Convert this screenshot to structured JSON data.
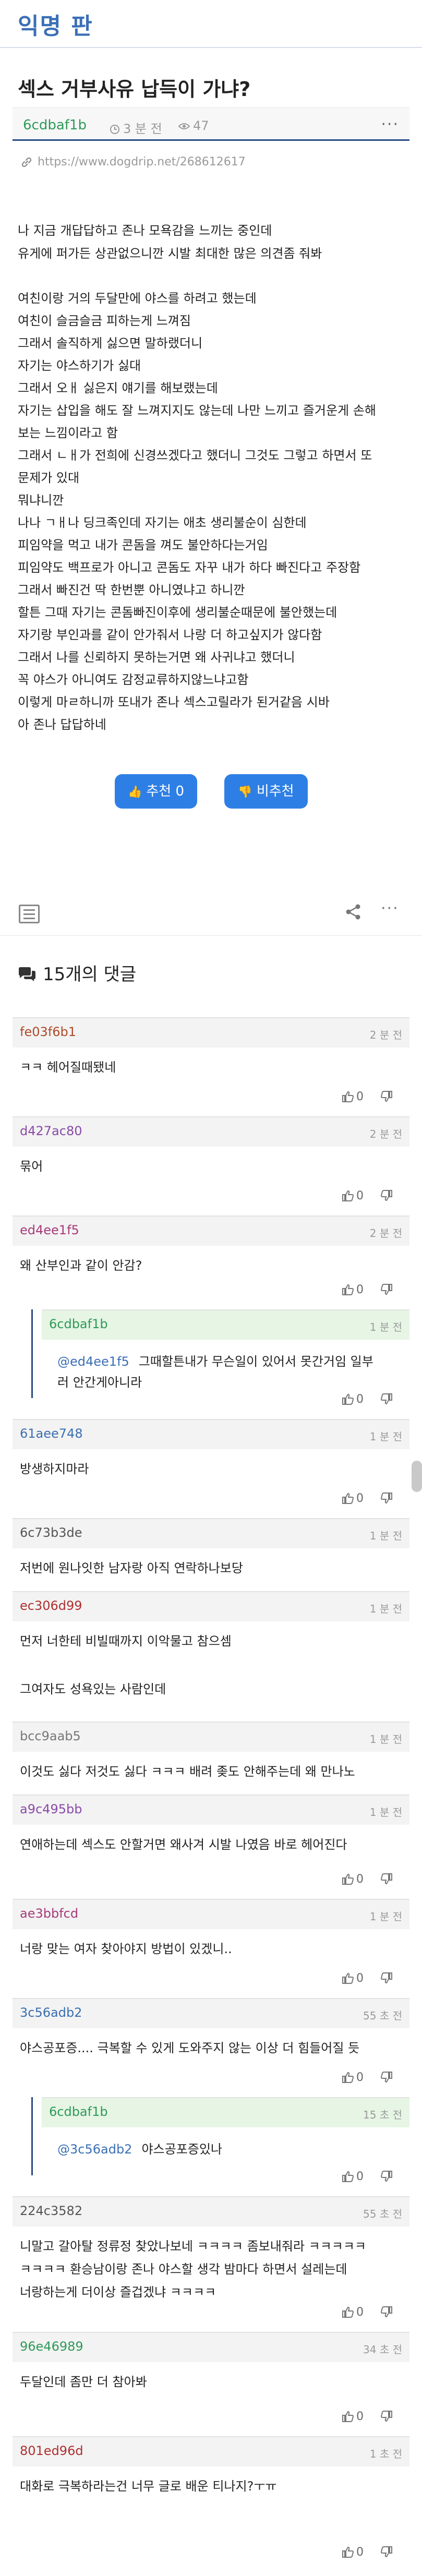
{
  "board": {
    "title": "익명 판"
  },
  "post": {
    "title": "섹스 거부사유 납득이 가냐?",
    "author": "6cdbaf1b",
    "time": "3 분 전",
    "views": "47",
    "more": "···",
    "url": "https://www.dogdrip.net/268612617",
    "body_lines": [
      "나 지금 개답답하고 존나 모욕감을 느끼는 중인데",
      "유게에 퍼가든 상관없으니깐 시발 최대한 많은 의견좀 줘봐",
      "",
      "여친이랑 거의 두달만에 야스를 하려고 했는데",
      "여친이 슬금슬금 피하는게 느껴짐",
      "그래서 솔직하게 싫으면 말하랬더니",
      "자기는 야스하기가 싫대",
      "그래서 오ㅐ 싫은지 얘기를 해보랬는데",
      "자기는 삽입을 해도 잘 느껴지지도 않는데 나만 느끼고 즐거운게 손해",
      "보는 느낌이라고 함",
      "그래서 ㄴㅐ가 전희에 신경쓰겠다고 했더니 그것도 그렇고 하면서 또",
      "문제가 있대",
      "뭐냐니깐",
      "나나 ㄱㅐ나 딩크족인데 자기는 애초 생리불순이 심한데",
      "피임약을 먹고 내가 콘돔을 껴도 불안하다는거임",
      "피임약도 백프로가 아니고 콘돔도 자꾸 내가 하다 빠진다고 주장함",
      "그래서 빠진건 딱 한번뿐 아니였냐고 하니깐",
      "할튼 그때 자기는 콘돔빠진이후에 생리불순때문에 불안했는데",
      "자기랑 부인과를 같이 안가줘서 나랑 더 하고싶지가 않다함",
      "그래서 나를 신뢰하지 못하는거면 왜 사귀냐고 했더니",
      "꼭 야스가 아니여도 감정교류하지않느냐고함",
      "이렇게 마ㄹ하니까 또내가 존나 섹스고릴라가 된거같음 시바",
      "아 존나 답답하네"
    ],
    "upvote_label": "추천 0",
    "downvote_label": "비추천"
  },
  "comments_header": "15개의 댓글",
  "comments": [
    {
      "nick": "fe03f6b1",
      "nick_color": "#b04a2a",
      "ago": "2 분 전",
      "text": "ㅋㅋ 헤어질때됐네",
      "likes": "0",
      "reply": false
    },
    {
      "nick": "d427ac80",
      "nick_color": "#8a4aa8",
      "ago": "2 분 전",
      "text": "묶어",
      "likes": "0",
      "reply": false
    },
    {
      "nick": "ed4ee1f5",
      "nick_color": "#a83a7a",
      "ago": "2 분 전",
      "text": "왜 산부인과 같이 안감?",
      "likes": "0",
      "reply": false
    },
    {
      "nick": "6cdbaf1b",
      "nick_color": "#2e9a58",
      "ago": "1 분 전",
      "mention": "@ed4ee1f5",
      "text": "그때할튼내가 무슨일이 있어서 못간거임 일부",
      "text2": "러 안간게아니라",
      "likes": "0",
      "reply": true
    },
    {
      "nick": "61aee748",
      "nick_color": "#3a6fb0",
      "ago": "1 분 전",
      "text": "방생하지마라",
      "likes": "0",
      "reply": false
    },
    {
      "nick": "6c73b3de",
      "nick_color": "#555555",
      "ago": "1 분 전",
      "text": "저번에 원나잇한 남자랑 아직 연락하나보당",
      "likes": "",
      "reply": false
    },
    {
      "nick": "ec306d99",
      "nick_color": "#b03030",
      "ago": "1 분 전",
      "text": "먼저 너한테 비빌때까지 이악물고 참으셈",
      "text2": "그여자도 성욕있는 사람인데",
      "likes": "",
      "reply": false
    },
    {
      "nick": "bcc9aab5",
      "nick_color": "#777777",
      "ago": "1 분 전",
      "text": "이것도 싫다 저것도 싫다 ㅋㅋㅋ 배려 좆도 안해주는데 왜 만나노",
      "likes": "",
      "reply": false
    },
    {
      "nick": "a9c495bb",
      "nick_color": "#8a4aa8",
      "ago": "1 분 전",
      "text": "연애하는데 섹스도 안할거면 왜사겨 시발 나였음 바로 헤어진다",
      "likes": "0",
      "reply": false
    },
    {
      "nick": "ae3bbfcd",
      "nick_color": "#a83a7a",
      "ago": "1 분 전",
      "text": "너랑 맞는 여자 찾아야지 방법이 있겠니..",
      "likes": "0",
      "reply": false
    },
    {
      "nick": "3c56adb2",
      "nick_color": "#3a6fb0",
      "ago": "55 초 전",
      "text": "야스공포증.... 극복할 수 있게 도와주지 않는 이상 더 힘들어질 듯",
      "likes": "0",
      "reply": false
    },
    {
      "nick": "6cdbaf1b",
      "nick_color": "#2e9a58",
      "ago": "15 초 전",
      "mention": "@3c56adb2",
      "text": "야스공포증있나",
      "likes": "0",
      "reply": true
    },
    {
      "nick": "224c3582",
      "nick_color": "#555555",
      "ago": "55 초 전",
      "text": "니말고 갈아탈 정류정 찾았나보네 ㅋㅋㅋㅋ 좀보내줘라 ㅋㅋㅋㅋㅋ",
      "text2": "ㅋㅋㅋㅋ 환승남이랑 존나 야스할 생각 밤마다 하면서 설레는데",
      "text3": "너랑하는게 더이상 즐겁겠냐 ㅋㅋㅋㅋ",
      "likes": "0",
      "reply": false
    },
    {
      "nick": "96e46989",
      "nick_color": "#2e9a58",
      "ago": "34 초 전",
      "text": "두달인데 좀만 더 참아봐",
      "likes": "0",
      "reply": false
    },
    {
      "nick": "801ed96d",
      "nick_color": "#b03030",
      "ago": "1 초 전",
      "text": "대화로 극복하라는건 너무 글로 배운 티나지?ㅜㅠ",
      "likes": "0",
      "reply": false
    }
  ]
}
